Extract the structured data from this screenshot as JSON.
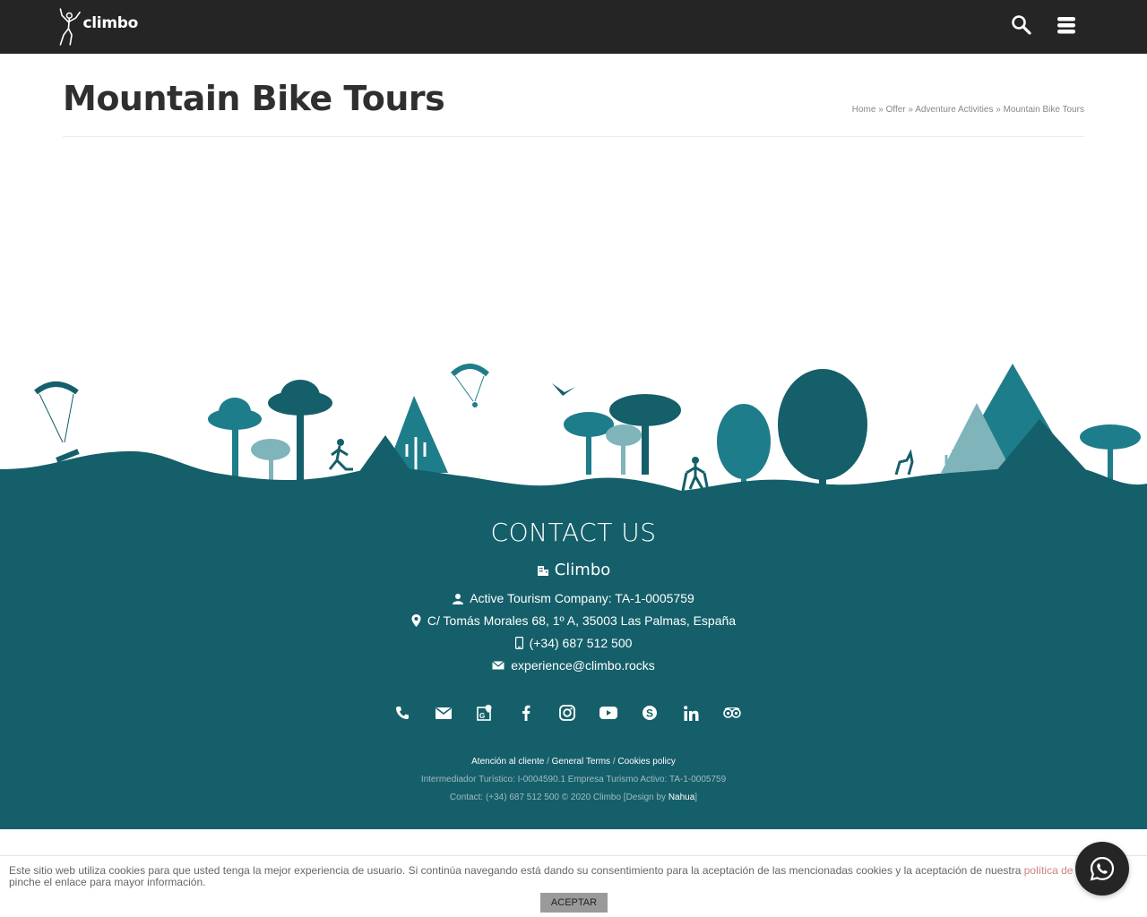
{
  "header": {
    "logo_text": "climbo",
    "search_icon": "search-icon",
    "menu_icon": "menu-icon"
  },
  "page": {
    "title": "Mountain Bike Tours",
    "breadcrumb": {
      "home": "Home",
      "offer": "Offer",
      "adventure": "Adventure Activities",
      "current": "Mountain Bike Tours",
      "separator": "»"
    }
  },
  "footer": {
    "heading": "CONTACT US",
    "company": "Climbo",
    "license": "Active Tourism Company: TA-1-0005759",
    "address": "C/ Tomás Morales 68, 1º A, 35003 Las Palmas, España",
    "phone": "(+34) 687 512 500",
    "email": "experience@climbo.rocks",
    "social": [
      "phone-icon",
      "mail-icon",
      "google-maps-icon",
      "facebook-icon",
      "instagram-icon",
      "youtube-icon",
      "skype-icon",
      "linkedin-icon",
      "tripadvisor-icon"
    ],
    "legal": {
      "customer": "Atención al cliente",
      "terms": "General Terms",
      "cookies": "Cookies policy",
      "separator": "/"
    },
    "registration": "Intermediador Turístico: I-0004590.1 Empresa Turismo Activo: TA-1-0005759",
    "copyright_prefix": "Contact: (+34) 687 512 500 © 2020 Climbo [Design by ",
    "designer": "Nahua",
    "copyright_suffix": "]"
  },
  "cookie": {
    "text": "Este sitio web utiliza cookies para que usted tenga la mejor experiencia de usuario. Si continúa navegando está dando su consentimiento para la aceptación de las mencionadas cookies y la aceptación de nuestra ",
    "link": "política de cookies",
    "text_after": ", pinche el enlace para mayor información.",
    "accept": "ACEPTAR"
  },
  "colors": {
    "header_bg": "#252525",
    "footer_bg": "#155f6a",
    "teal_light": "#1e7d8a",
    "teal_pale": "#7fb4bb"
  }
}
